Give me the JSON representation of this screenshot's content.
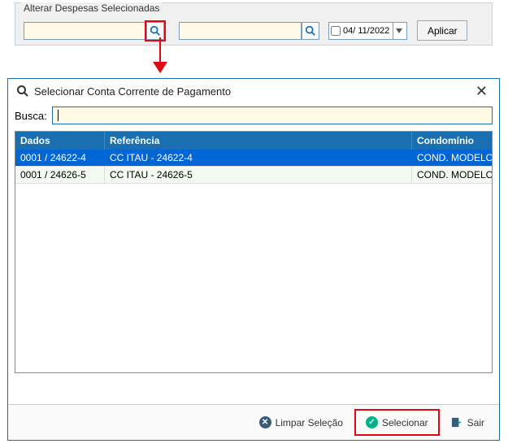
{
  "top": {
    "title": "Alterar Despesas Selecionadas",
    "input1_value": "",
    "input2_value": "",
    "date_value": "04/ 11/2022",
    "apply_label": "Aplicar"
  },
  "modal": {
    "title": "Selecionar Conta Corrente de Pagamento",
    "search_label": "Busca:",
    "search_value": "",
    "columns": {
      "dados": "Dados",
      "referencia": "Referência",
      "cond": "Condomínio"
    },
    "rows": [
      {
        "dados": "0001 / 24622-4",
        "referencia": "CC ITAU - 24622-4",
        "cond": "COND. MODELO I"
      },
      {
        "dados": "0001 / 24626-5",
        "referencia": "CC ITAU - 24626-5",
        "cond": "COND. MODELO I"
      }
    ],
    "buttons": {
      "clear": "Limpar Seleção",
      "select": "Selecionar",
      "exit": "Sair"
    }
  }
}
